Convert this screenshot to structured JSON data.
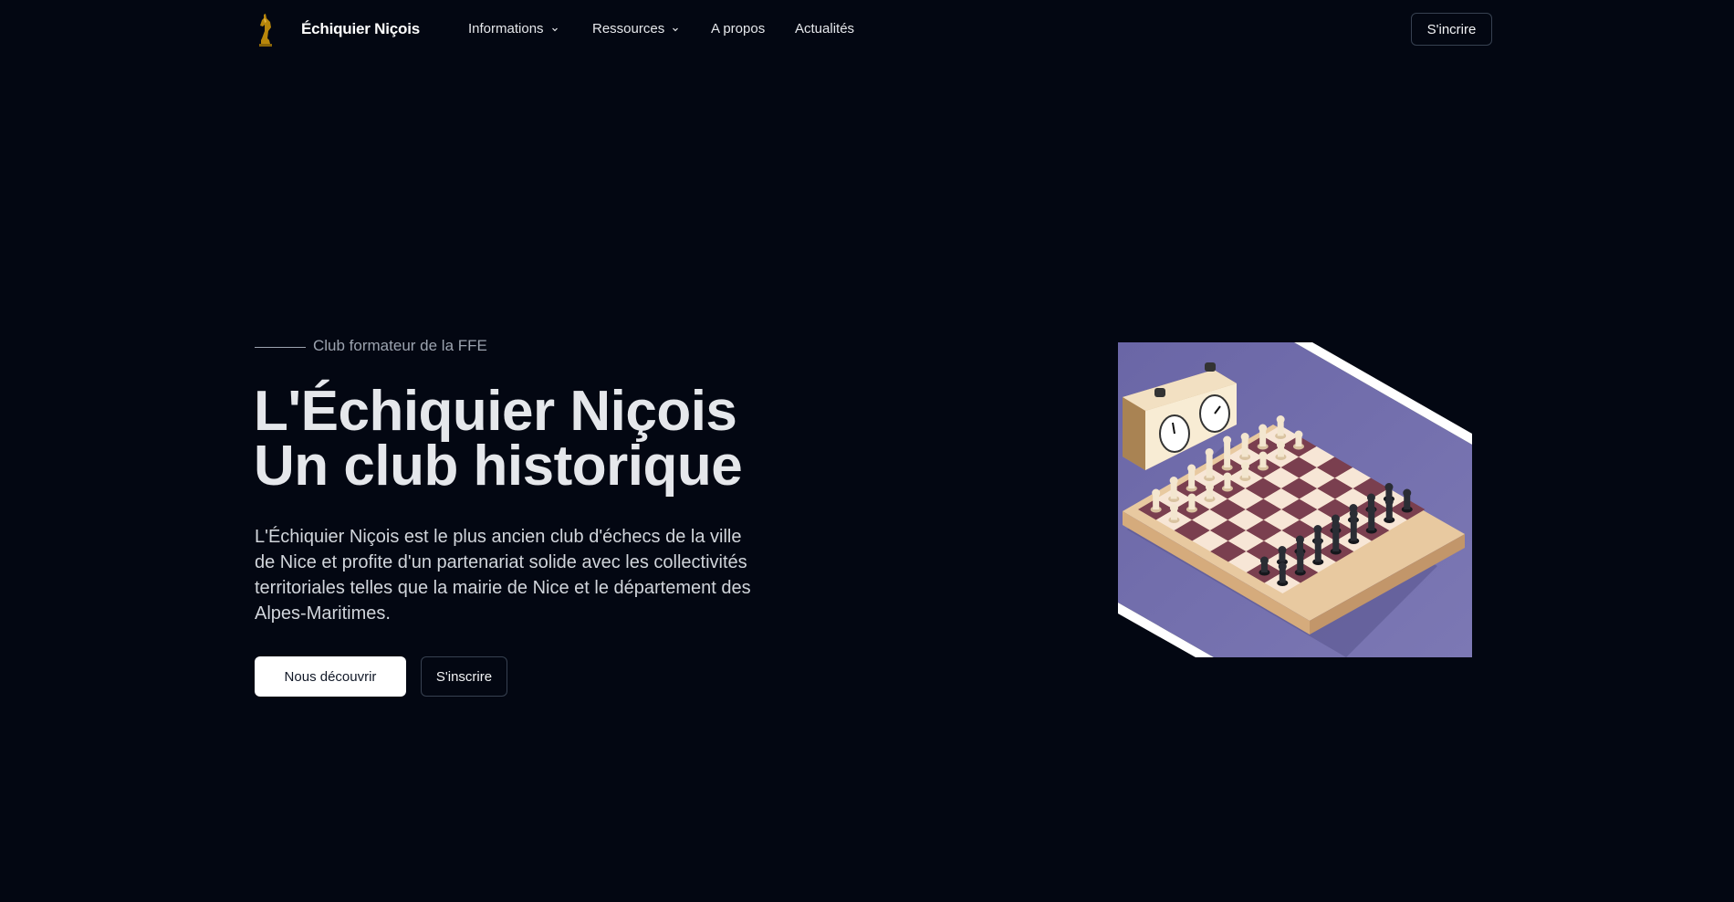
{
  "header": {
    "brand": "Échiquier Niçois",
    "nav": [
      {
        "label": "Informations",
        "has_dropdown": true
      },
      {
        "label": "Ressources",
        "has_dropdown": true
      },
      {
        "label": "A propos",
        "has_dropdown": false
      },
      {
        "label": "Actualités",
        "has_dropdown": false
      }
    ],
    "signup_label": "S'incrire"
  },
  "hero": {
    "eyebrow": "Club formateur de la FFE",
    "title_line1": "L'Échiquier Niçois",
    "title_line2": "Un club historique",
    "description": "L'Échiquier Niçois est le plus ancien club d'échecs de la ville de Nice et profite d'un partenariat solide avec les collectivités territoriales telles que la mairie de Nice et le département des Alpes-Maritimes.",
    "primary_button": "Nous découvrir",
    "secondary_button": "S'inscrire"
  },
  "colors": {
    "background": "#030712",
    "text": "#e5e7eb",
    "muted": "#9ca3af",
    "illustration_bg": "#6e6aa6",
    "board_dark": "#7a3f4f",
    "board_light": "#f7e6d6"
  },
  "icons": {
    "logo": "chess-knight-logo",
    "dropdown": "chevron-down-icon"
  }
}
